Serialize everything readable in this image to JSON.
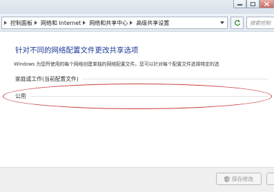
{
  "address_bar": {
    "crumbs": [
      "控制面板",
      "网络和 Internet",
      "网络和共享中心",
      "高级共享设置"
    ]
  },
  "search": {
    "placeholder": "搜索控制"
  },
  "main": {
    "heading": "针对不同的网络配置文件更改共享选项",
    "description": "Windows 为您所使用的每个网络创建单独的网络配置文件。您可以针对每个配置文件选择特定的选",
    "profiles": [
      {
        "label": "家庭或工作(当前配置文件)"
      },
      {
        "label": "公用"
      }
    ]
  },
  "footer": {
    "save_label": "保存修改"
  },
  "icons": {
    "nav": "chevron-right-icon",
    "dropdown": "chevron-down-icon",
    "refresh": "refresh-icon",
    "save": "shield-icon"
  },
  "colors": {
    "heading": "#1e3c96",
    "annotation_ellipse": "#c83b3b",
    "disabled_text": "#9a9a9a"
  }
}
